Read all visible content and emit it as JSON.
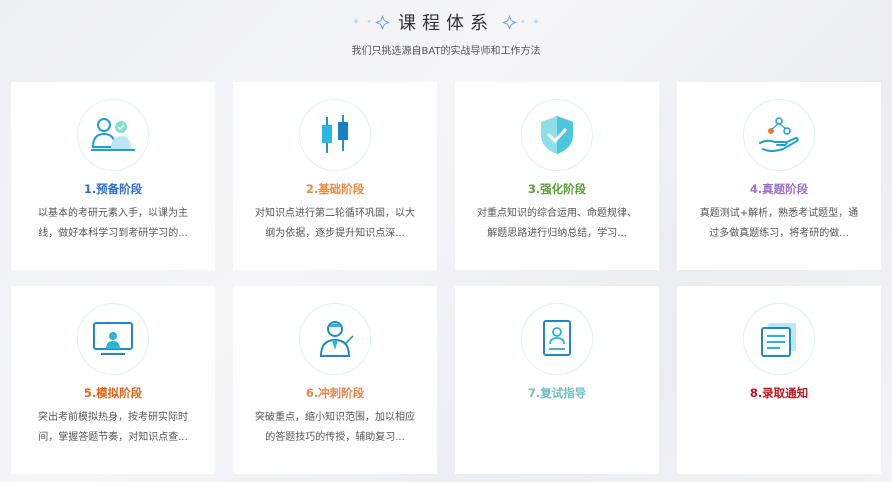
{
  "header": {
    "title": "课程体系",
    "subtitle": "我们只挑选源自BAT的实战导师和工作方法"
  },
  "cards": [
    {
      "title": "1.预备阶段",
      "color": "#2f6fd0",
      "icon": "people-icon",
      "line1": "以基本的考研元素入手，以课为主",
      "line2": "线，做好本科学习到考研学习的..."
    },
    {
      "title": "2.基础阶段",
      "color": "#ee8a3c",
      "icon": "candlestick-icon",
      "line1": "对知识点进行第二轮循环巩固，以大",
      "line2": "纲为依据，逐步提升知识点深..."
    },
    {
      "title": "3.强化阶段",
      "color": "#5b9e3a",
      "icon": "shield-check-icon",
      "line1": "对重点知识的综合运用、命题规律、",
      "line2": "解题思路进行归纳总结，学习..."
    },
    {
      "title": "4.真题阶段",
      "color": "#9c73c4",
      "icon": "hand-molecule-icon",
      "line1": "真题测试+解析，熟悉考试题型，通",
      "line2": "过多做真题练习，将考研的做..."
    },
    {
      "title": "5.模拟阶段",
      "color": "#e0661c",
      "icon": "presentation-board-icon",
      "line1": "突出考前模拟热身，按考研实际时",
      "line2": "间，掌握答题节奏，对知识点查..."
    },
    {
      "title": "6.冲刺阶段",
      "color": "#e98450",
      "icon": "teacher-icon",
      "line1": "突破重点，缩小知识范围，加以相应",
      "line2": "的答题技巧的传授，辅助复习..."
    },
    {
      "title": "7.复试指导",
      "color": "#74bfc0",
      "icon": "resume-document-icon",
      "line1": "",
      "line2": ""
    },
    {
      "title": "8.录取通知",
      "color": "#c4161d",
      "icon": "notice-cards-icon",
      "line1": "",
      "line2": ""
    }
  ]
}
